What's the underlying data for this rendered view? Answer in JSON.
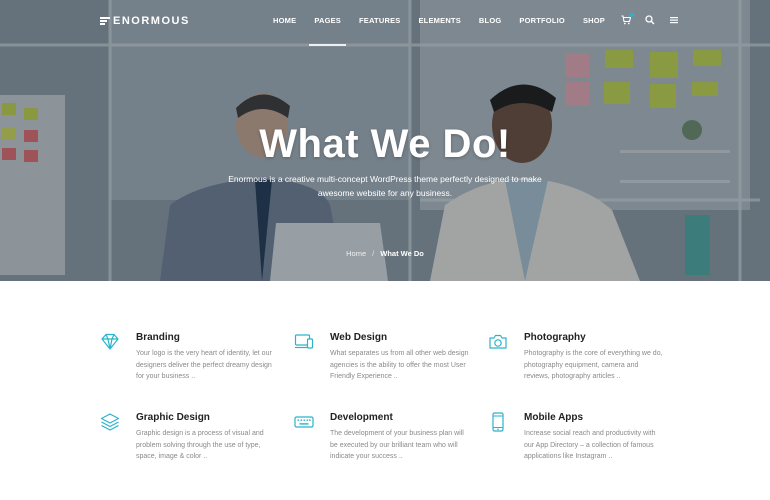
{
  "brand": {
    "name": "ENORMOUS"
  },
  "nav": {
    "items": [
      "HOME",
      "PAGES",
      "FEATURES",
      "ELEMENTS",
      "BLOG",
      "PORTFOLIO",
      "SHOP"
    ],
    "active": "PAGES",
    "icons": [
      "cart-icon",
      "search-icon",
      "menu-icon"
    ]
  },
  "hero": {
    "title": "What We Do!",
    "subtitle": "Enormous is a creative multi-concept WordPress theme perfectly designed to make awesome website for any business.",
    "breadcrumb": {
      "home": "Home",
      "separator": "/",
      "current": "What We Do"
    }
  },
  "services": [
    {
      "title": "Branding",
      "icon": "diamond-icon",
      "desc": "Your logo is the very heart of identity, let our designers deliver the perfect dreamy design for your business .."
    },
    {
      "title": "Web Design",
      "icon": "devices-icon",
      "desc": "What separates us from all other web design agencies is the ability to offer the most User Friendly Experience .."
    },
    {
      "title": "Photography",
      "icon": "camera-icon",
      "desc": "Photography is the core of everything we do, photography equipment, camera and reviews, photography articles .."
    },
    {
      "title": "Graphic Design",
      "icon": "layers-icon",
      "desc": "Graphic design is a process of visual and problem solving through the use of type, space, image & color .."
    },
    {
      "title": "Development",
      "icon": "keyboard-icon",
      "desc": "The development of your business plan will be executed by our brilliant team who will indicate your success .."
    },
    {
      "title": "Mobile Apps",
      "icon": "mobile-icon",
      "desc": "Increase social reach and productivity with our App Directory – a collection of famous applications like Instagram .."
    }
  ],
  "colors": {
    "accent": "#2ab4c9",
    "title": "#222222",
    "text": "#8a8a8a"
  }
}
